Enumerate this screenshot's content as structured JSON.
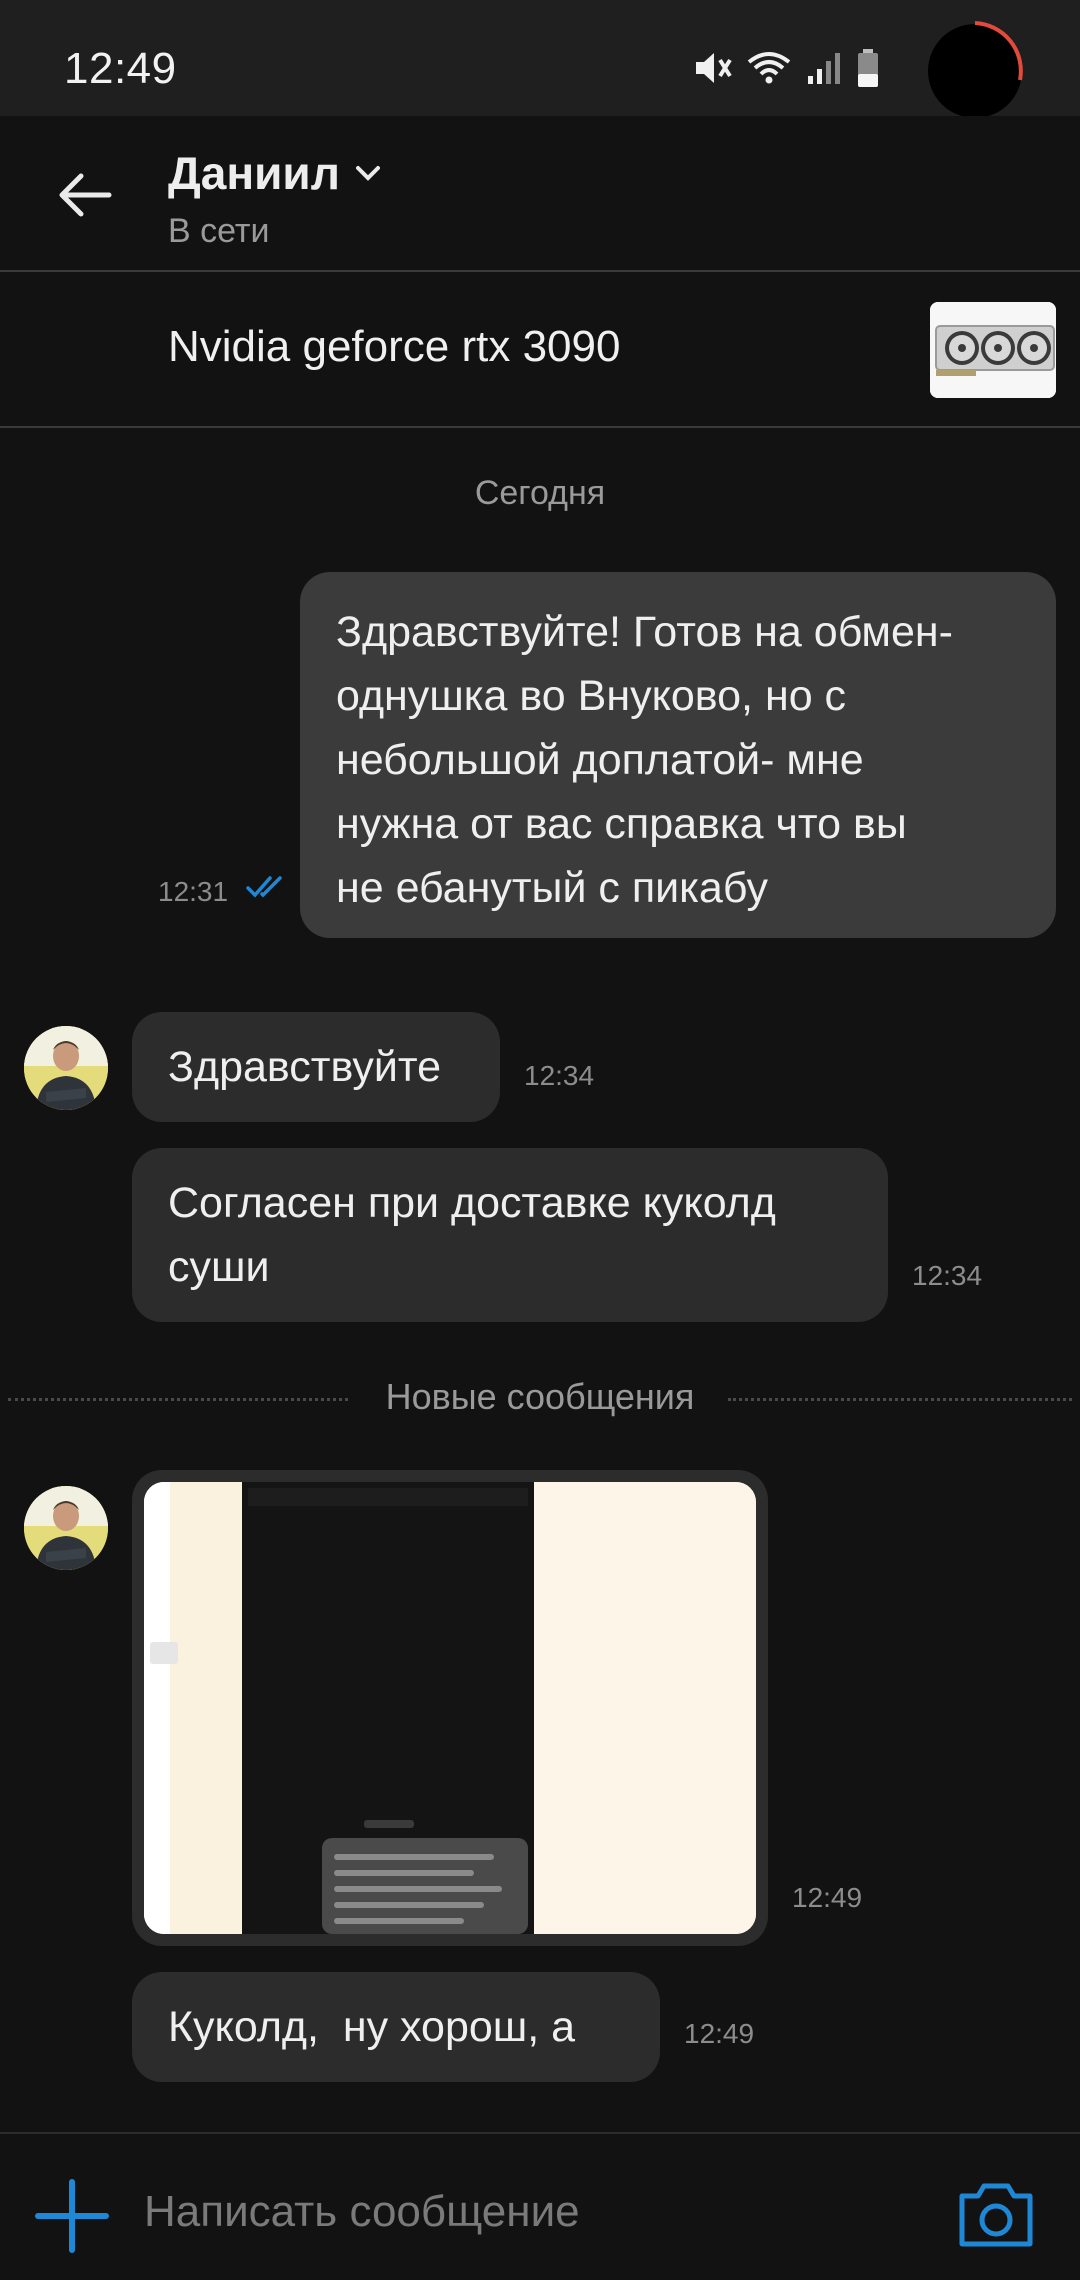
{
  "status_bar": {
    "time": "12:49"
  },
  "header": {
    "contact_name": "Даниил",
    "contact_status": "В сети"
  },
  "product": {
    "title": "Nvidia geforce rtx 3090"
  },
  "chat": {
    "date_separator": "Сегодня",
    "messages": [
      {
        "direction": "outgoing",
        "text": "Здравствуйте! Готов на обмен-\nоднушка во Внуково, но с\nнебольшой доплатой- мне\nнужна от вас справка что вы\nне ебанутый с пикабу",
        "time": "12:31",
        "read": true
      },
      {
        "direction": "incoming",
        "text": "Здравствуйте",
        "time": "12:34"
      },
      {
        "direction": "incoming",
        "text": "Согласен при доставке куколд\nсуши",
        "time": "12:34"
      },
      {
        "direction": "incoming",
        "type": "image",
        "time": "12:49"
      },
      {
        "direction": "incoming",
        "text": "Куколд,  ну хорош, а",
        "time": "12:49"
      }
    ],
    "new_messages_separator": "Новые сообщения"
  },
  "composer": {
    "placeholder": "Написать сообщение"
  },
  "colors": {
    "accent": "#1e88d6",
    "bubble_out": "#3b3b3b",
    "bubble_in": "#2c2c2c",
    "background": "#121212"
  }
}
